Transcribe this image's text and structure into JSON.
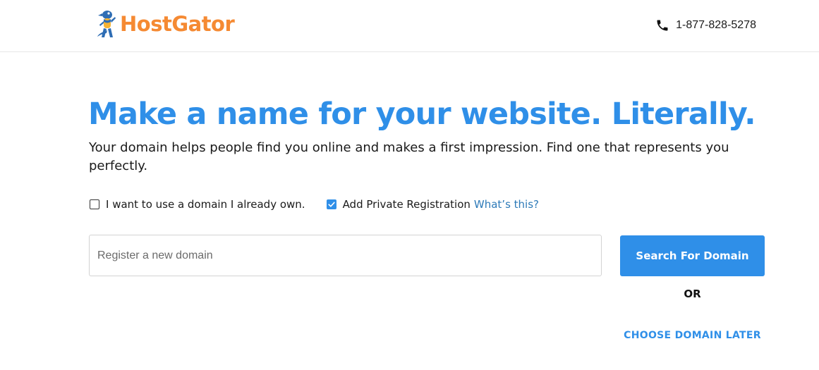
{
  "header": {
    "logo_text": "HostGator",
    "phone": "1-877-828-5278"
  },
  "hero": {
    "headline": "Make a name for your website. Literally.",
    "subtext": "Your domain helps people find you online and makes a first impression. Find one that represents you perfectly."
  },
  "options": {
    "own_domain_label": "I want to use a domain I already own.",
    "own_domain_checked": false,
    "private_reg_label": "Add Private Registration",
    "private_reg_checked": true,
    "whats_this_link": "What’s this?"
  },
  "search": {
    "placeholder": "Register a new domain",
    "value": "",
    "button_label": "Search For Domain",
    "or_label": "OR",
    "choose_later_label": "CHOOSE DOMAIN LATER"
  },
  "colors": {
    "brand_orange": "#f58a33",
    "primary_blue": "#2f8fe8",
    "link_blue": "#2d7ab8"
  },
  "icons": {
    "logo": "gator-mascot-icon",
    "phone": "phone-icon",
    "checkmark": "checkmark-icon"
  }
}
